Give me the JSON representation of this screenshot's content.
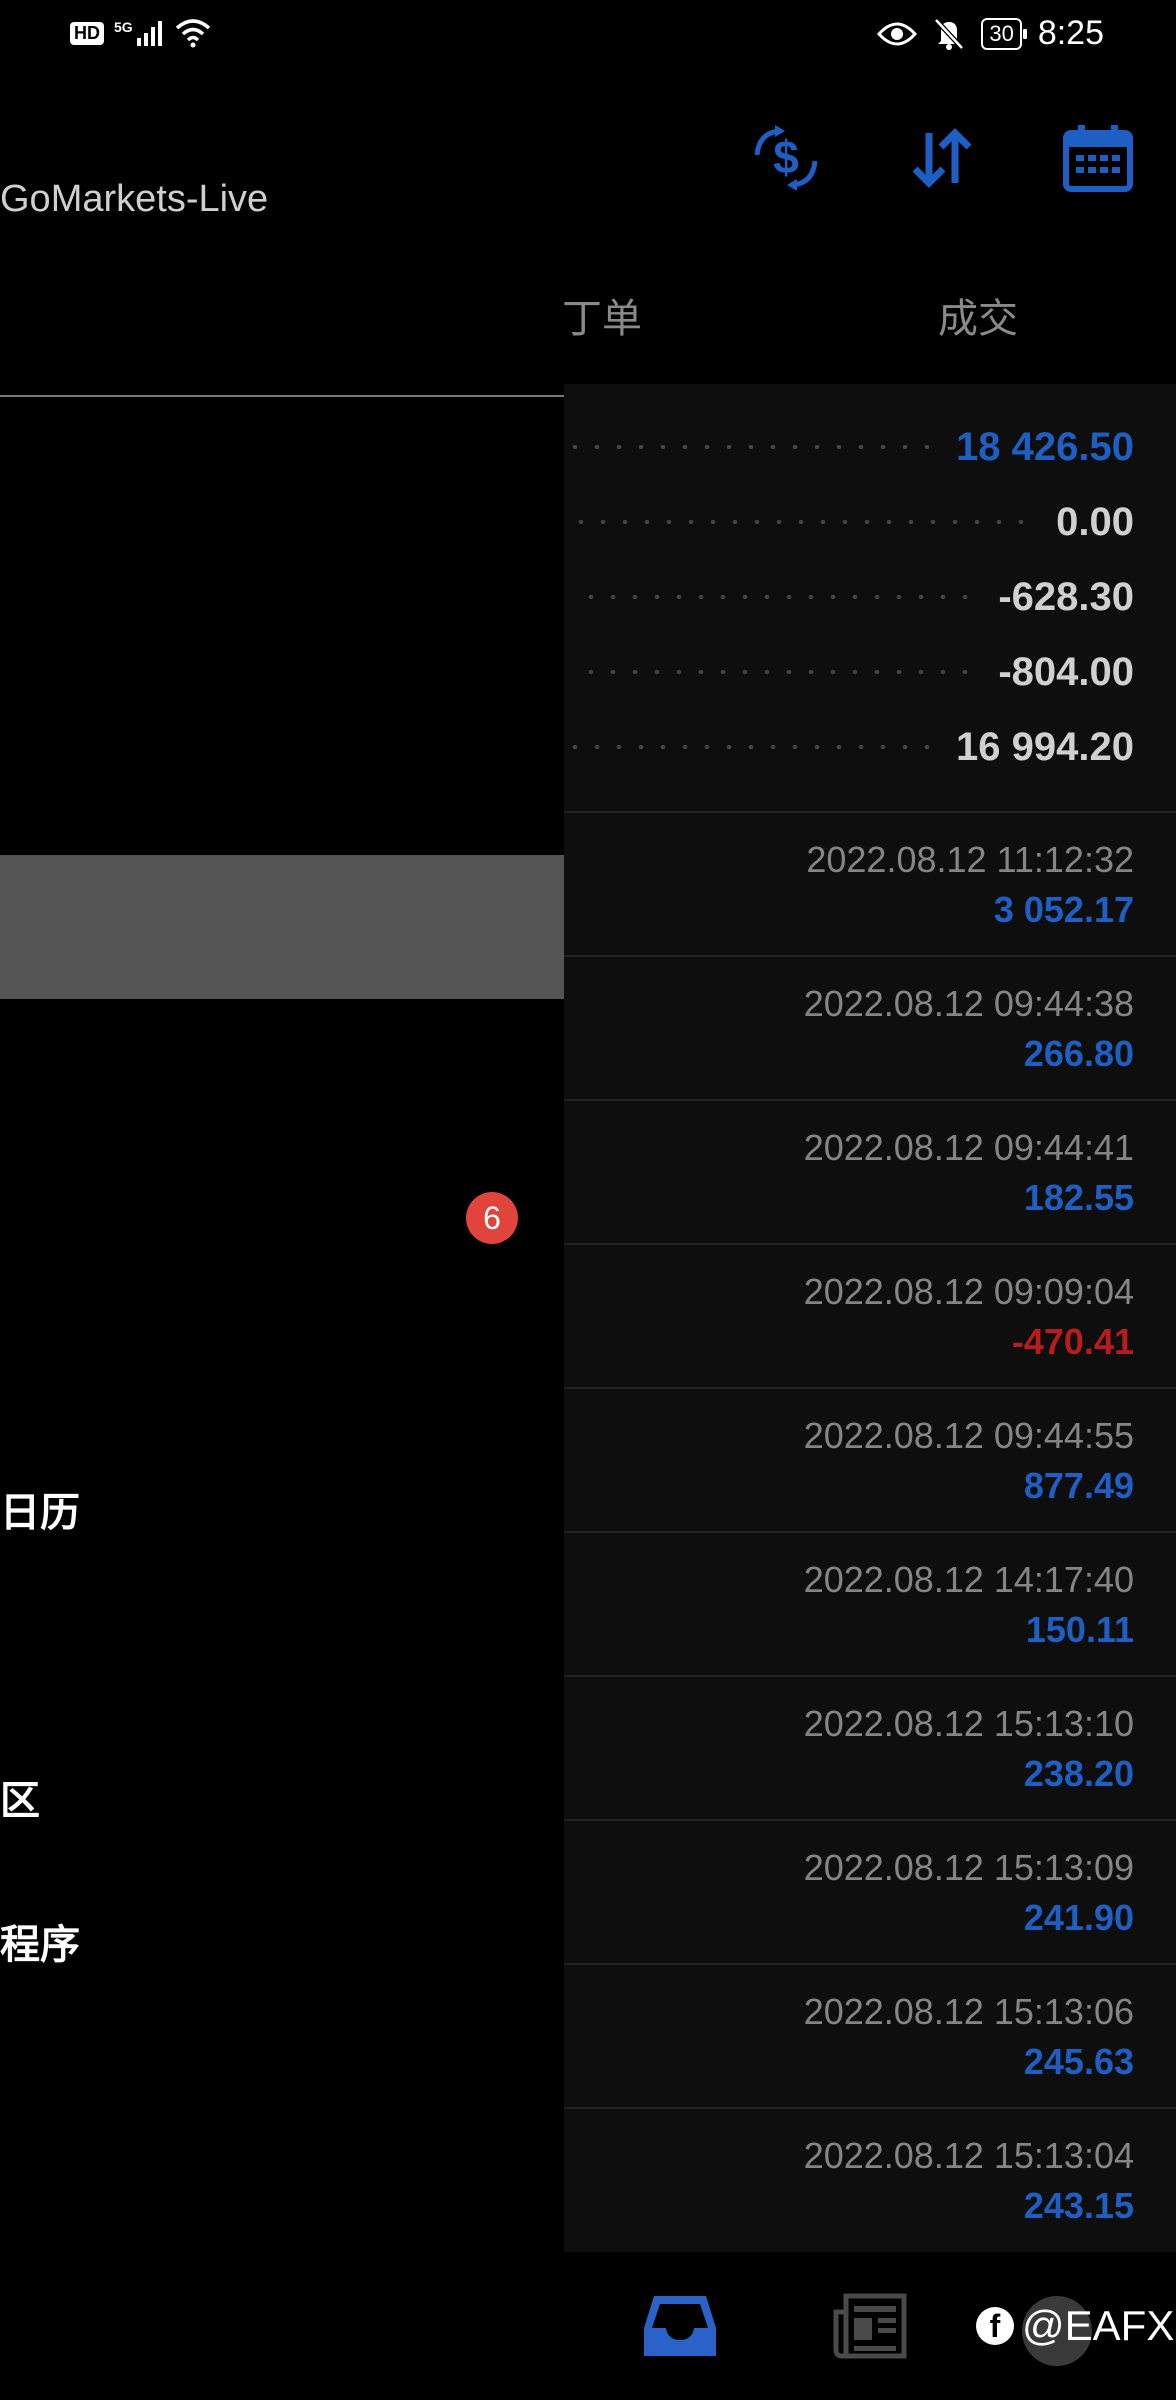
{
  "status_bar": {
    "hd": "HD",
    "network": "5G",
    "battery": "30",
    "time": "8:25"
  },
  "header": {
    "account": "GoMarkets-Live",
    "icons": [
      "currency-exchange-icon",
      "sort-icon",
      "calendar-icon"
    ]
  },
  "tabs": {
    "orders": "丁单",
    "deals": "成交"
  },
  "summary": [
    {
      "value": "18 426.50",
      "highlight": true
    },
    {
      "value": "0.00",
      "highlight": false
    },
    {
      "value": "-628.30",
      "highlight": false
    },
    {
      "value": "-804.00",
      "highlight": false
    },
    {
      "value": "16 994.20",
      "highlight": false
    }
  ],
  "deals": [
    {
      "time": "2022.08.12 11:12:32",
      "profit": "3 052.17",
      "negative": false
    },
    {
      "time": "2022.08.12 09:44:38",
      "profit": "266.80",
      "negative": false
    },
    {
      "time": "2022.08.12 09:44:41",
      "profit": "182.55",
      "negative": false
    },
    {
      "time": "2022.08.12 09:09:04",
      "profit": "-470.41",
      "negative": true
    },
    {
      "time": "2022.08.12 09:44:55",
      "profit": "877.49",
      "negative": false
    },
    {
      "time": "2022.08.12 14:17:40",
      "profit": "150.11",
      "negative": false
    },
    {
      "time": "2022.08.12 15:13:10",
      "profit": "238.20",
      "negative": false
    },
    {
      "time": "2022.08.12 15:13:09",
      "profit": "241.90",
      "negative": false
    },
    {
      "time": "2022.08.12 15:13:06",
      "profit": "245.63",
      "negative": false
    },
    {
      "time": "2022.08.12 15:13:04",
      "profit": "243.15",
      "negative": false
    }
  ],
  "drawer": {
    "badge_count": "6",
    "menu": {
      "calendar": "日历",
      "community": "区",
      "apps": "程序"
    }
  },
  "watermark": "@EAFX",
  "colors": {
    "accent_blue": "#1f5fc4",
    "negative_red": "#b81c1c",
    "badge_red": "#e0443a"
  }
}
